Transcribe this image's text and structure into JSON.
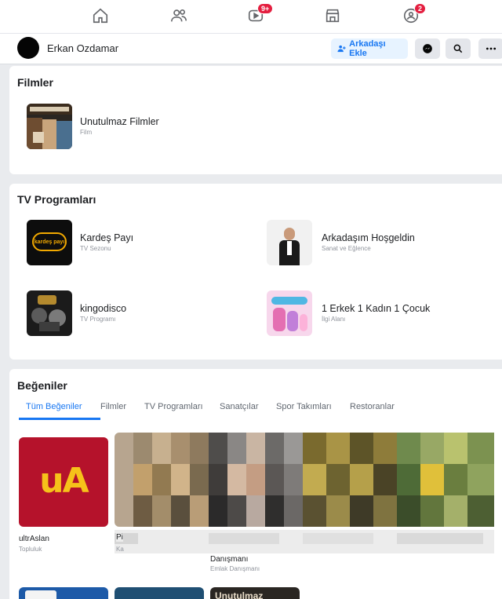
{
  "nav": {
    "icons": [
      "home-icon",
      "friends-icon",
      "watch-icon",
      "marketplace-icon",
      "groups-icon"
    ],
    "watch_badge": "9+",
    "groups_badge": "2"
  },
  "profile": {
    "name": "Erkan Ozdamar",
    "add_friend_label": "Arkadaşı Ekle"
  },
  "movies": {
    "title": "Filmler",
    "items": [
      {
        "name": "Unutulmaz Filmler",
        "category": "Film"
      }
    ]
  },
  "tv": {
    "title": "TV Programları",
    "items": [
      {
        "name": "Kardeş Payı",
        "category": "TV Sezonu",
        "thumb_text": "kardeş payı"
      },
      {
        "name": "Arkadaşım Hoşgeldin",
        "category": "Sanat ve Eğlence"
      },
      {
        "name": "kingodisco",
        "category": "TV Programı"
      },
      {
        "name": "1 Erkek 1 Kadın 1 Çocuk",
        "category": "İlgi Alanı"
      }
    ]
  },
  "likes": {
    "title": "Beğeniler",
    "tabs": [
      "Tüm Beğeniler",
      "Filmler",
      "TV Programları",
      "Sanatçılar",
      "Spor Takımları",
      "Restoranlar"
    ],
    "active_tab": "Tüm Beğeniler",
    "tiles": [
      {
        "name": "ultrAslan",
        "category": "Topluluk",
        "logo_text": "uA"
      },
      {
        "name": "Pi",
        "category": "Ka"
      },
      {
        "name": "",
        "category": "Emlak Danışmanı",
        "name_tail": "Danışmanı"
      }
    ],
    "bottom_tile_text": "Unutulmaz"
  },
  "colors": {
    "accent": "#1877f2",
    "badge": "#e41e3f",
    "ultraslan_bg": "#b5122b",
    "ultraslan_logo": "#f6c21a"
  }
}
